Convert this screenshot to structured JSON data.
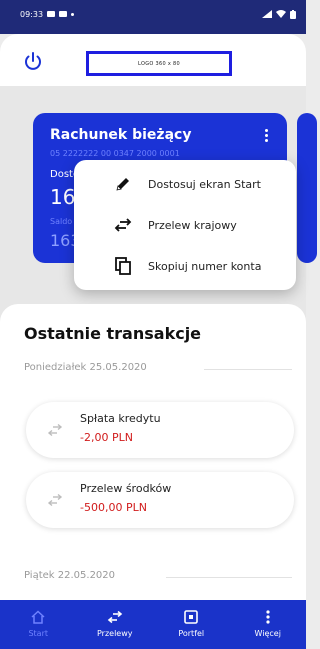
{
  "status_bar": {
    "time": "09:33"
  },
  "header": {
    "logo_text": "LOGO 360 x 80"
  },
  "account_card": {
    "title": "Rachunek bieżący",
    "account_number": "05 2222222 00 0347 2000 0001",
    "available_label": "Dostępne",
    "available_amount": "165 0",
    "balance_label": "Saldo",
    "balance_amount": "163 9"
  },
  "context_menu": {
    "items": [
      {
        "label": "Dostosuj ekran Start",
        "icon": "pencil-icon"
      },
      {
        "label": "Przelew krajowy",
        "icon": "transfer-icon"
      },
      {
        "label": "Skopiuj numer konta",
        "icon": "copy-icon"
      }
    ]
  },
  "carousel": {
    "page_count": 2,
    "active_page": 1
  },
  "transactions": {
    "title": "Ostatnie transakcje",
    "groups": [
      {
        "date": "Poniedziałek 25.05.2020",
        "items": [
          {
            "name": "Spłata kredytu",
            "amount": "-2,00 PLN"
          },
          {
            "name": "Przelew środków",
            "amount": "-500,00 PLN"
          }
        ]
      },
      {
        "date": "Piątek 22.05.2020",
        "items": []
      }
    ]
  },
  "bottom_nav": {
    "items": [
      {
        "label": "Start",
        "icon": "home-icon",
        "active": true
      },
      {
        "label": "Przelewy",
        "icon": "transfer-icon",
        "active": false
      },
      {
        "label": "Portfel",
        "icon": "wallet-icon",
        "active": false
      },
      {
        "label": "Więcej",
        "icon": "more-icon",
        "active": false
      }
    ]
  },
  "colors": {
    "primary": "#1b33d6",
    "status_bar": "#1f2a78",
    "negative_amount": "#d11c1c"
  }
}
